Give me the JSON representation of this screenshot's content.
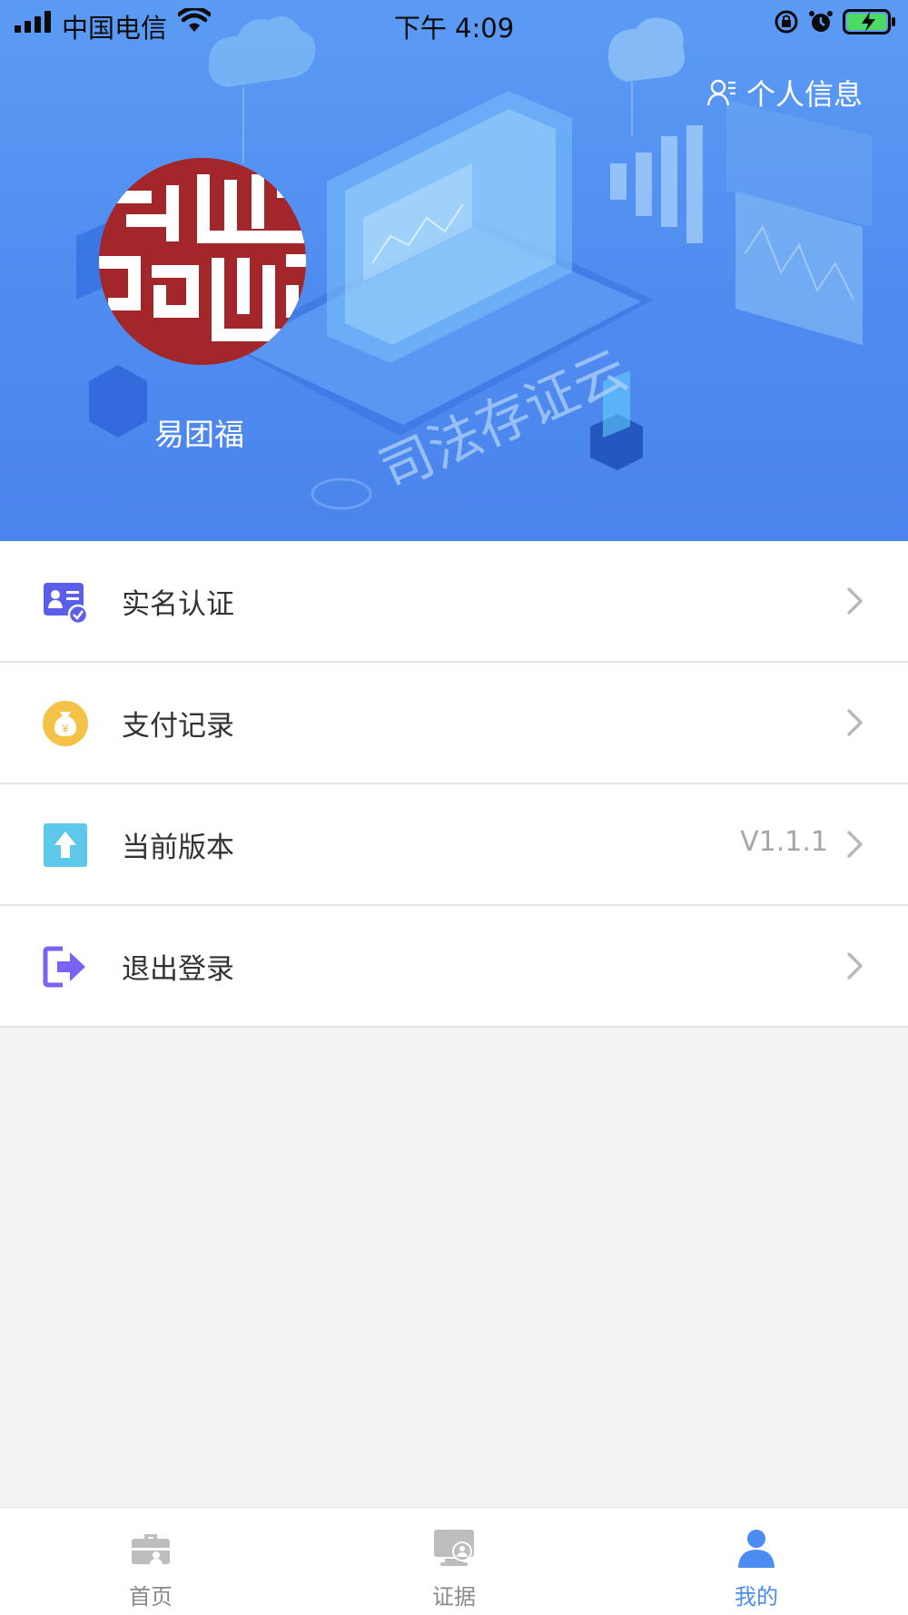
{
  "status_bar": {
    "carrier": "中国电信",
    "time": "下午 4:09",
    "icons": [
      "signal-icon",
      "wifi-icon",
      "rotation-lock-icon",
      "alarm-icon",
      "battery-charging-icon"
    ]
  },
  "header": {
    "profile_link_label": "个人信息",
    "user_name": "易团福",
    "background_text": "司法存证云"
  },
  "menu": {
    "items": [
      {
        "label": "实名认证",
        "icon": "id-card-verified-icon",
        "value": ""
      },
      {
        "label": "支付记录",
        "icon": "money-bag-icon",
        "value": ""
      },
      {
        "label": "当前版本",
        "icon": "upload-arrow-icon",
        "value": "V1.1.1"
      },
      {
        "label": "退出登录",
        "icon": "logout-icon",
        "value": ""
      }
    ]
  },
  "tabbar": {
    "tabs": [
      {
        "label": "首页",
        "icon": "briefcase-icon",
        "active": false
      },
      {
        "label": "证据",
        "icon": "evidence-monitor-icon",
        "active": false
      },
      {
        "label": "我的",
        "icon": "person-icon",
        "active": true
      }
    ]
  },
  "colors": {
    "header_blue": "#4f8cf0",
    "accent_blue": "#4a8cf2",
    "avatar_red": "#a3272a",
    "money_yellow": "#f5c249",
    "upload_cyan": "#5ec8ea",
    "logout_purple": "#7b61f5",
    "idcard_indigo": "#5a5ee8"
  }
}
